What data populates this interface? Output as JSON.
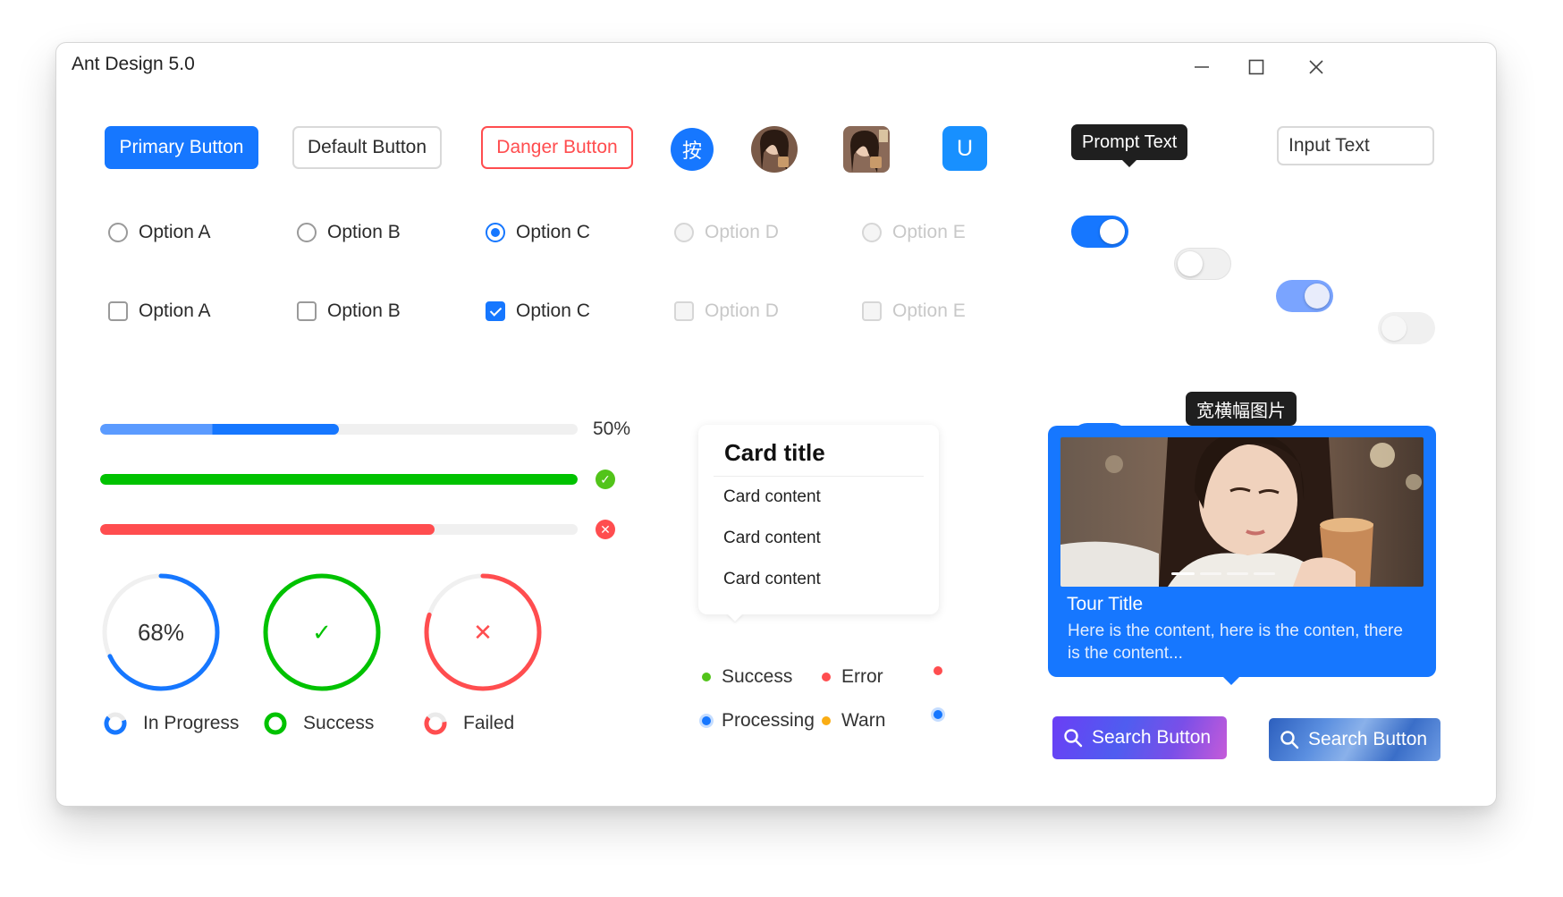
{
  "window": {
    "title": "Ant Design 5.0"
  },
  "buttons": {
    "primary": "Primary Button",
    "default": "Default Button",
    "danger": "Danger Button",
    "round_char": "按"
  },
  "avatar_letter": "U",
  "tooltip": "Prompt Text",
  "input": {
    "value": "Input Text"
  },
  "radios": [
    {
      "label": "Option A",
      "checked": false,
      "disabled": false
    },
    {
      "label": "Option B",
      "checked": false,
      "disabled": false
    },
    {
      "label": "Option C",
      "checked": true,
      "disabled": false
    },
    {
      "label": "Option D",
      "checked": false,
      "disabled": true
    },
    {
      "label": "Option E",
      "checked": false,
      "disabled": true
    }
  ],
  "checkboxes": [
    {
      "label": "Option A",
      "checked": false,
      "disabled": false
    },
    {
      "label": "Option B",
      "checked": false,
      "disabled": false
    },
    {
      "label": "Option C",
      "checked": true,
      "disabled": false
    },
    {
      "label": "Option D",
      "checked": false,
      "disabled": true
    },
    {
      "label": "Option E",
      "checked": false,
      "disabled": true
    }
  ],
  "switches": {
    "row1": [
      "on",
      "off",
      "on-disabled",
      "off-disabled"
    ],
    "row2": [
      "on",
      "off",
      "on-disabled",
      "off-disabled"
    ]
  },
  "progress_lines": [
    {
      "percent": 50,
      "label": "50%",
      "status": "active",
      "color": "#1677ff"
    },
    {
      "percent": 100,
      "status": "success",
      "color": "#00c200"
    },
    {
      "percent": 70,
      "status": "exception",
      "color": "#ff4d4f"
    }
  ],
  "progress_circles": [
    {
      "percent": 68,
      "label": "68%",
      "status": "normal",
      "color": "#1677ff"
    },
    {
      "percent": 100,
      "label": "✓",
      "status": "success",
      "color": "#00c200"
    },
    {
      "percent": 80,
      "label": "✕",
      "status": "exception",
      "color": "#ff4d4f"
    }
  ],
  "mini_legend": [
    {
      "label": "In Progress",
      "color": "#1677ff"
    },
    {
      "label": "Success",
      "color": "#00c200"
    },
    {
      "label": "Failed",
      "color": "#ff4d4f"
    }
  ],
  "card": {
    "title": "Card title",
    "items": [
      "Card content",
      "Card content",
      "Card content"
    ]
  },
  "badges": [
    {
      "label": "Success",
      "color": "#52c41a"
    },
    {
      "label": "Error",
      "color": "#ff4d4f"
    },
    {
      "label": "",
      "color": "#ff4d4f"
    },
    {
      "label": "Processing",
      "color": "#1677ff"
    },
    {
      "label": "Warn",
      "color": "#faad14"
    },
    {
      "label": "",
      "color": "#1677ff"
    }
  ],
  "image_tooltip": "宽横幅图片",
  "tour": {
    "title": "Tour Title",
    "description": "Here is the content, here is the conten, there is the content..."
  },
  "search_buttons": [
    "Search Button",
    "Search Button"
  ],
  "colors": {
    "primary": "#1677ff",
    "success": "#00c200",
    "error": "#ff4d4f",
    "warn": "#faad14"
  }
}
